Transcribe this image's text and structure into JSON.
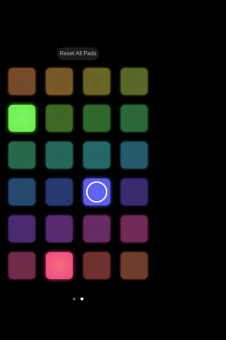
{
  "header": {
    "reset_label": "Reset All Pads"
  },
  "colors": {
    "background": "#000000",
    "reset_button_bg": "#1c1c1e",
    "reset_button_text": "#b9b9bc",
    "dot_active": "#ffffff",
    "dot_inactive": "#5a5a5e"
  },
  "pads": [
    {
      "row": 1,
      "col": 1,
      "state": "dim",
      "color": "#7a4a2a",
      "inner": "#6f4a2c"
    },
    {
      "row": 1,
      "col": 2,
      "state": "dim",
      "color": "#7a5a26",
      "inner": "#72552a"
    },
    {
      "row": 1,
      "col": 3,
      "state": "dim",
      "color": "#6c6624",
      "inner": "#66602a"
    },
    {
      "row": 1,
      "col": 4,
      "state": "dim",
      "color": "#586a24",
      "inner": "#56642a"
    },
    {
      "row": 2,
      "col": 1,
      "state": "lit",
      "color": "#6cf04a",
      "inner": "#7df56a"
    },
    {
      "row": 2,
      "col": 2,
      "state": "dim",
      "color": "#3f6a22",
      "inner": "#3e6428"
    },
    {
      "row": 2,
      "col": 3,
      "state": "dim",
      "color": "#2f6a2a",
      "inner": "#30642e"
    },
    {
      "row": 2,
      "col": 4,
      "state": "dim",
      "color": "#2a6a3a",
      "inner": "#2c643c"
    },
    {
      "row": 3,
      "col": 1,
      "state": "dim",
      "color": "#266a4a",
      "inner": "#28644a"
    },
    {
      "row": 3,
      "col": 2,
      "state": "dim",
      "color": "#246a5c",
      "inner": "#276458"
    },
    {
      "row": 3,
      "col": 3,
      "state": "dim",
      "color": "#246a6a",
      "inner": "#266464"
    },
    {
      "row": 3,
      "col": 4,
      "state": "dim",
      "color": "#245c6e",
      "inner": "#275a68"
    },
    {
      "row": 4,
      "col": 1,
      "state": "dim",
      "color": "#244a70",
      "inner": "#27486a"
    },
    {
      "row": 4,
      "col": 2,
      "state": "dim",
      "color": "#283a72",
      "inner": "#2a3a6a"
    },
    {
      "row": 4,
      "col": 3,
      "state": "selected",
      "color": "#5a5cf0",
      "inner": "#6466f5"
    },
    {
      "row": 4,
      "col": 4,
      "state": "dim",
      "color": "#3a2a72",
      "inner": "#3a2c6a"
    },
    {
      "row": 5,
      "col": 1,
      "state": "dim",
      "color": "#4a2a72",
      "inner": "#482c6a"
    },
    {
      "row": 5,
      "col": 2,
      "state": "dim",
      "color": "#5a2a72",
      "inner": "#562c6a"
    },
    {
      "row": 5,
      "col": 3,
      "state": "dim",
      "color": "#6a2a66",
      "inner": "#642c60"
    },
    {
      "row": 5,
      "col": 4,
      "state": "dim",
      "color": "#722a58",
      "inner": "#6a2c54"
    },
    {
      "row": 6,
      "col": 1,
      "state": "dim",
      "color": "#722a4a",
      "inner": "#6a2c46"
    },
    {
      "row": 6,
      "col": 2,
      "state": "lit",
      "color": "#f04a82",
      "inner": "#f5707a"
    },
    {
      "row": 6,
      "col": 3,
      "state": "dim",
      "color": "#72302e",
      "inner": "#6a322e"
    },
    {
      "row": 6,
      "col": 4,
      "state": "dim",
      "color": "#723e2a",
      "inner": "#6a3e2c"
    }
  ],
  "pagination": {
    "dots": [
      {
        "state": "inactive"
      },
      {
        "state": "active"
      }
    ]
  }
}
